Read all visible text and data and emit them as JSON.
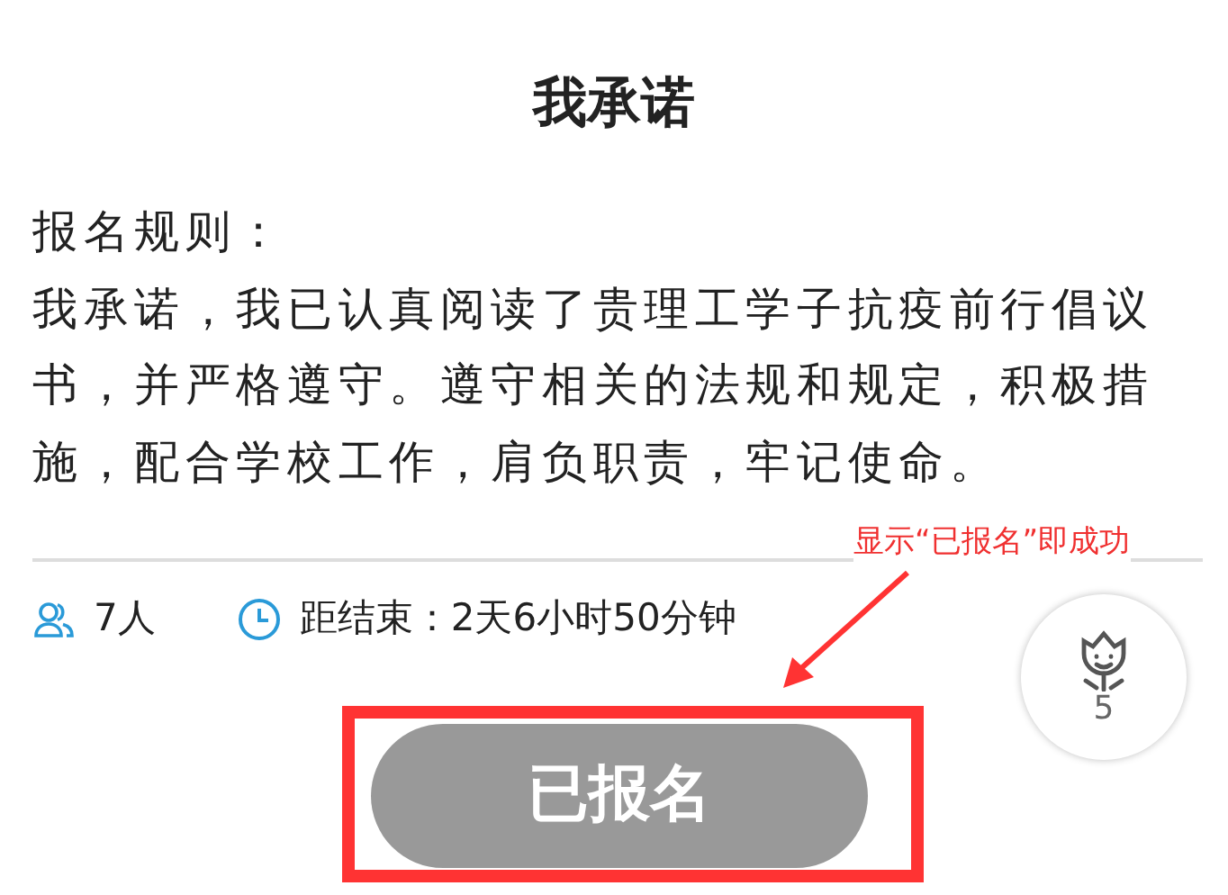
{
  "title": "我承诺",
  "rules_label": "报名规则：",
  "rules_text": "我承诺，我已认真阅读了贵理工学子抗疫前行倡议书，并严格遵守。遵守相关的法规和规定，积极措施，配合学校工作，肩负职责，牢记使命。",
  "participants": "7人",
  "countdown": "距结束：2天6小时50分钟",
  "signup_button": {
    "label": "已报名",
    "disabled": true
  },
  "like_count": "5",
  "annotation": {
    "text": "显示“已报名”即成功"
  }
}
